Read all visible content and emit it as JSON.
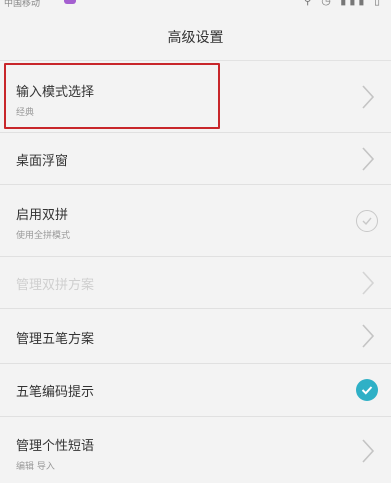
{
  "status_bar": {
    "carrier": "中国移动",
    "icons": "⚲ ◷ ▮▮▮ ▯"
  },
  "header": {
    "title": "高级设置"
  },
  "settings": [
    {
      "label": "输入模式选择",
      "sub": "经典",
      "control": "chevron",
      "highlighted": true
    },
    {
      "label": "桌面浮窗",
      "control": "chevron"
    },
    {
      "label": "启用双拼",
      "sub": "使用全拼模式",
      "control": "checkbox",
      "checked": false
    },
    {
      "label": "管理双拼方案",
      "control": "chevron",
      "disabled": true
    },
    {
      "label": "管理五笔方案",
      "control": "chevron"
    },
    {
      "label": "五笔编码提示",
      "control": "checkbox",
      "checked": true
    },
    {
      "label": "管理个性短语",
      "sub": "编辑  导入",
      "control": "chevron"
    }
  ],
  "colors": {
    "accent": "#2fb0c6",
    "highlight": "#c8262a",
    "background": "#f3f3f3"
  }
}
